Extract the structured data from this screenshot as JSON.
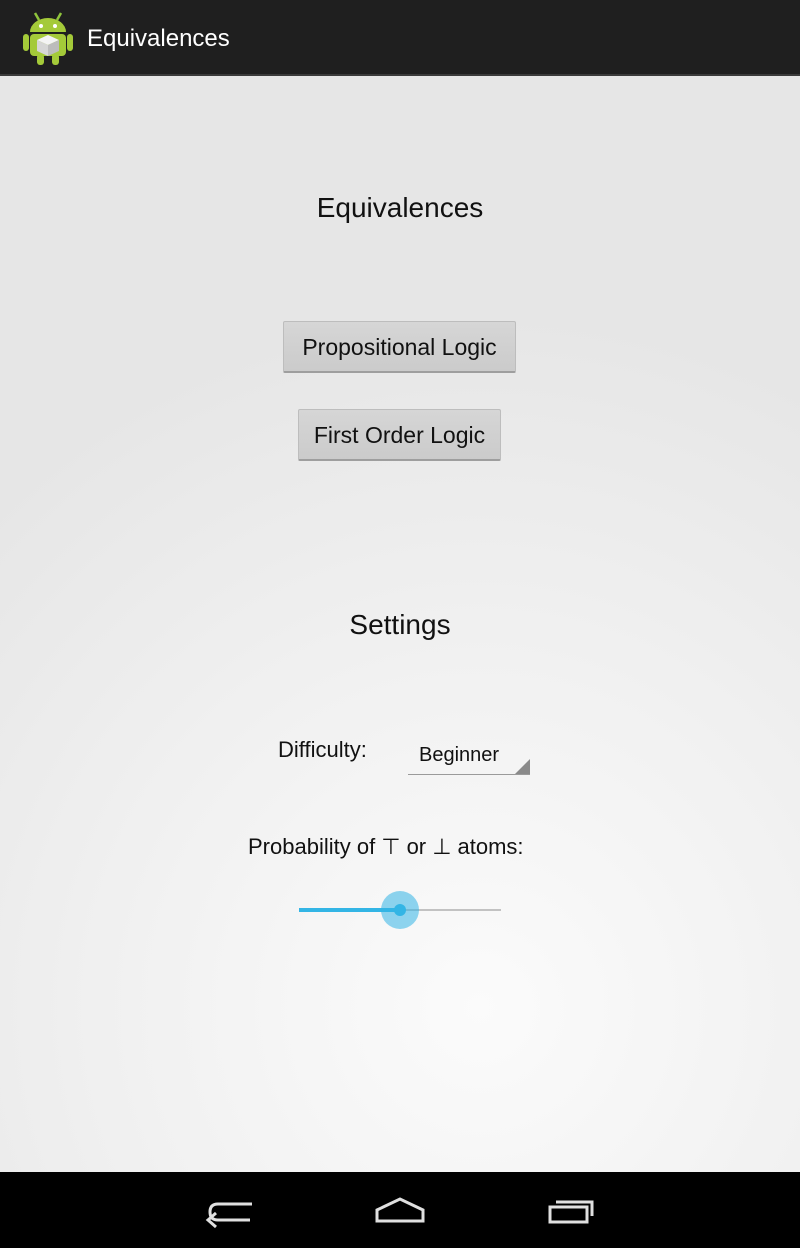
{
  "app": {
    "title": "Equivalences",
    "icon": "android-robot-icon"
  },
  "main": {
    "heading": "Equivalences",
    "buttons": {
      "propositional": "Propositional Logic",
      "first_order": "First Order Logic"
    }
  },
  "settings": {
    "heading": "Settings",
    "difficulty_label": "Difficulty:",
    "difficulty_value": "Beginner",
    "probability_label": "Probability of ⊤ or ⊥ atoms:",
    "probability_value_percent": 50
  },
  "colors": {
    "accent": "#33b5e5",
    "action_bar": "#1f1f1f"
  },
  "nav": {
    "back_icon": "back-icon",
    "home_icon": "home-icon",
    "recents_icon": "recent-apps-icon"
  }
}
